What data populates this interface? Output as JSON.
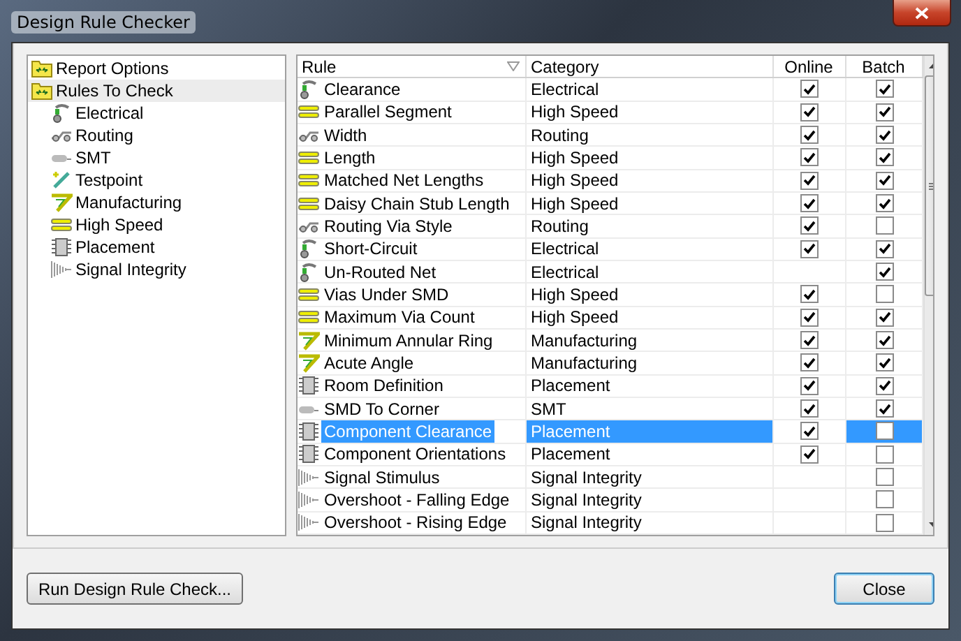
{
  "window": {
    "title": "Design Rule Checker"
  },
  "tree": [
    {
      "label": "Report Options",
      "kind": "folder",
      "selected": false
    },
    {
      "label": "Rules To Check",
      "kind": "folder",
      "selected": true,
      "children": [
        {
          "label": "Electrical",
          "kind": "electrical",
          "selected": false
        },
        {
          "label": "Routing",
          "kind": "routing",
          "selected": false
        },
        {
          "label": "SMT",
          "kind": "smt",
          "selected": false
        },
        {
          "label": "Testpoint",
          "kind": "testpoint",
          "selected": false
        },
        {
          "label": "Manufacturing",
          "kind": "manufacturing",
          "selected": false
        },
        {
          "label": "High Speed",
          "kind": "highspeed",
          "selected": false
        },
        {
          "label": "Placement",
          "kind": "placement",
          "selected": false
        },
        {
          "label": "Signal Integrity",
          "kind": "signal",
          "selected": false
        }
      ]
    }
  ],
  "table": {
    "columns": [
      "Rule",
      "Category",
      "Online",
      "Batch"
    ],
    "rows": [
      {
        "rule": "Clearance",
        "category": "Electrical",
        "kind": "electrical",
        "online": true,
        "batch": true,
        "selected": false
      },
      {
        "rule": "Parallel Segment",
        "category": "High Speed",
        "kind": "highspeed",
        "online": true,
        "batch": true,
        "selected": false
      },
      {
        "rule": "Width",
        "category": "Routing",
        "kind": "routing",
        "online": true,
        "batch": true,
        "selected": false
      },
      {
        "rule": "Length",
        "category": "High Speed",
        "kind": "highspeed",
        "online": true,
        "batch": true,
        "selected": false
      },
      {
        "rule": "Matched Net Lengths",
        "category": "High Speed",
        "kind": "highspeed",
        "online": true,
        "batch": true,
        "selected": false
      },
      {
        "rule": "Daisy Chain Stub Length",
        "category": "High Speed",
        "kind": "highspeed",
        "online": true,
        "batch": true,
        "selected": false
      },
      {
        "rule": "Routing Via Style",
        "category": "Routing",
        "kind": "routing",
        "online": true,
        "batch": false,
        "selected": false
      },
      {
        "rule": "Short-Circuit",
        "category": "Electrical",
        "kind": "electrical",
        "online": true,
        "batch": true,
        "selected": false
      },
      {
        "rule": "Un-Routed Net",
        "category": "Electrical",
        "kind": "electrical",
        "batch": true,
        "selected": false
      },
      {
        "rule": "Vias Under SMD",
        "category": "High Speed",
        "kind": "highspeed",
        "online": true,
        "batch": false,
        "selected": false
      },
      {
        "rule": "Maximum Via Count",
        "category": "High Speed",
        "kind": "highspeed",
        "online": true,
        "batch": true,
        "selected": false
      },
      {
        "rule": "Minimum Annular Ring",
        "category": "Manufacturing",
        "kind": "manufacturing",
        "online": true,
        "batch": true,
        "selected": false
      },
      {
        "rule": "Acute Angle",
        "category": "Manufacturing",
        "kind": "manufacturing",
        "online": true,
        "batch": true,
        "selected": false
      },
      {
        "rule": "Room Definition",
        "category": "Placement",
        "kind": "placement",
        "online": true,
        "batch": true,
        "selected": false
      },
      {
        "rule": "SMD To Corner",
        "category": "SMT",
        "kind": "smt",
        "online": true,
        "batch": true,
        "selected": false
      },
      {
        "rule": "Component Clearance",
        "category": "Placement",
        "kind": "placement",
        "online": true,
        "batch": false,
        "selected": true
      },
      {
        "rule": "Component Orientations",
        "category": "Placement",
        "kind": "placement",
        "online": true,
        "batch": false,
        "selected": false
      },
      {
        "rule": "Signal Stimulus",
        "category": "Signal Integrity",
        "kind": "signal",
        "batch": false,
        "selected": false
      },
      {
        "rule": "Overshoot - Falling Edge",
        "category": "Signal Integrity",
        "kind": "signal",
        "batch": false,
        "selected": false
      },
      {
        "rule": "Overshoot - Rising Edge",
        "category": "Signal Integrity",
        "kind": "signal",
        "batch": false,
        "selected": false
      }
    ]
  },
  "buttons": [
    "Run Design Rule Check...",
    "Close"
  ]
}
